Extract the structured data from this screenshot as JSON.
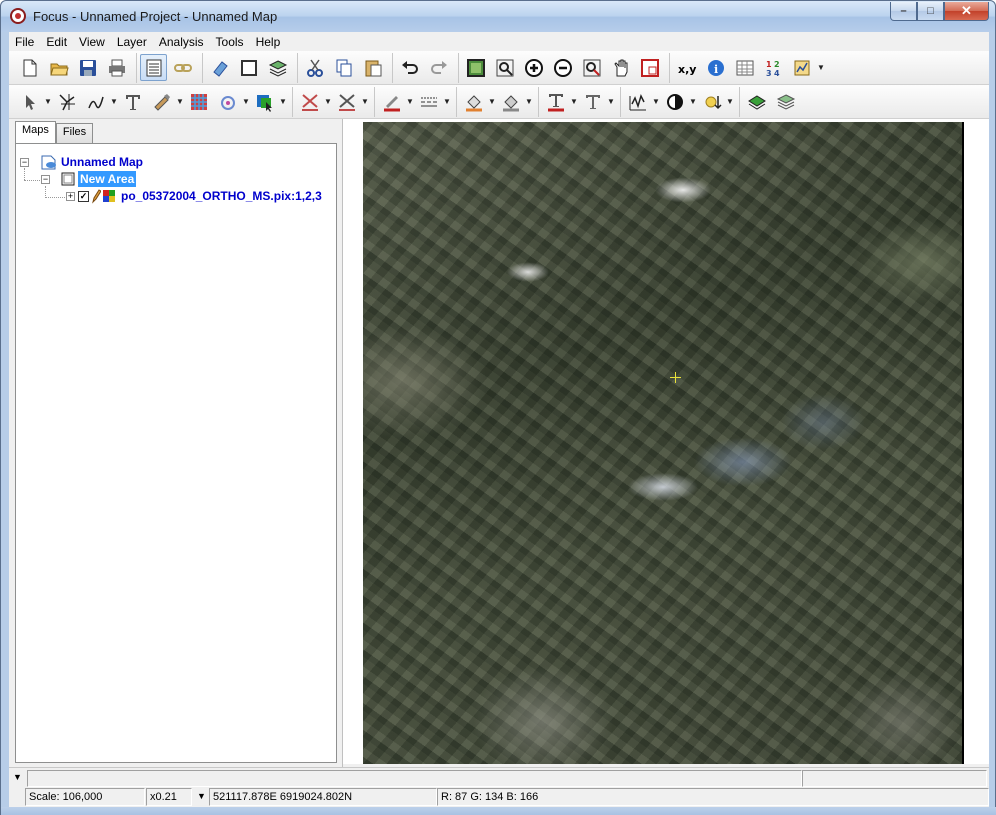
{
  "window": {
    "title": "Focus - Unnamed Project - Unnamed Map",
    "minimize": "–",
    "maximize": "□",
    "close": "✕"
  },
  "menu": [
    "File",
    "Edit",
    "View",
    "Layer",
    "Analysis",
    "Tools",
    "Help"
  ],
  "toolbar1": [
    [
      "new-file-icon",
      "open-folder-icon",
      "save-icon",
      "print-icon"
    ],
    [
      "layer-manager-icon",
      "link-icon"
    ],
    [
      "eraser-icon",
      "frame-icon",
      "layers-icon"
    ],
    [
      "cut-icon",
      "copy-icon",
      "paste-icon"
    ],
    [
      "undo-icon",
      "redo-icon"
    ],
    [
      "zoom-extent-icon",
      "zoom-box-icon",
      "zoom-in-icon",
      "zoom-out-icon",
      "zoom-layer-icon",
      "pan-hand-icon",
      "overview-icon"
    ],
    [
      "coordinates-icon",
      "info-icon",
      "table-icon",
      "numbers-icon",
      "chart-icon"
    ]
  ],
  "toolbar2": [
    [
      "select-arrow-icon",
      "vertex-edit-icon",
      "curve-draw-icon",
      "text-tool-icon",
      "paint-tool-icon",
      "grid-raster-icon",
      "fill-tool-icon",
      "color-box-icon"
    ],
    [
      "line-style-icon",
      "line-pattern-icon"
    ],
    [
      "line-color-icon",
      "dash-icon"
    ],
    [
      "fill-color-icon",
      "shade-icon"
    ],
    [
      "text-color-icon",
      "text-format-icon"
    ],
    [
      "histogram-icon",
      "contrast-icon",
      "brightness-icon"
    ],
    [
      "display-layer-icon",
      "stack-layers-icon"
    ]
  ],
  "tabs": {
    "maps": "Maps",
    "files": "Files"
  },
  "tree": {
    "map": {
      "expander": "−",
      "label": "Unnamed Map"
    },
    "area": {
      "expander": "−",
      "label": "New Area"
    },
    "layer": {
      "expander": "+",
      "checkbox": "✓",
      "label": "po_05372004_ORTHO_MS.pix:1,2,3"
    }
  },
  "status": {
    "scale": "Scale: 106,000",
    "zoom": "x0.21",
    "coords": "521117.878E 6919024.802N",
    "pixel": "R:   87 G:  134 B:  166"
  }
}
